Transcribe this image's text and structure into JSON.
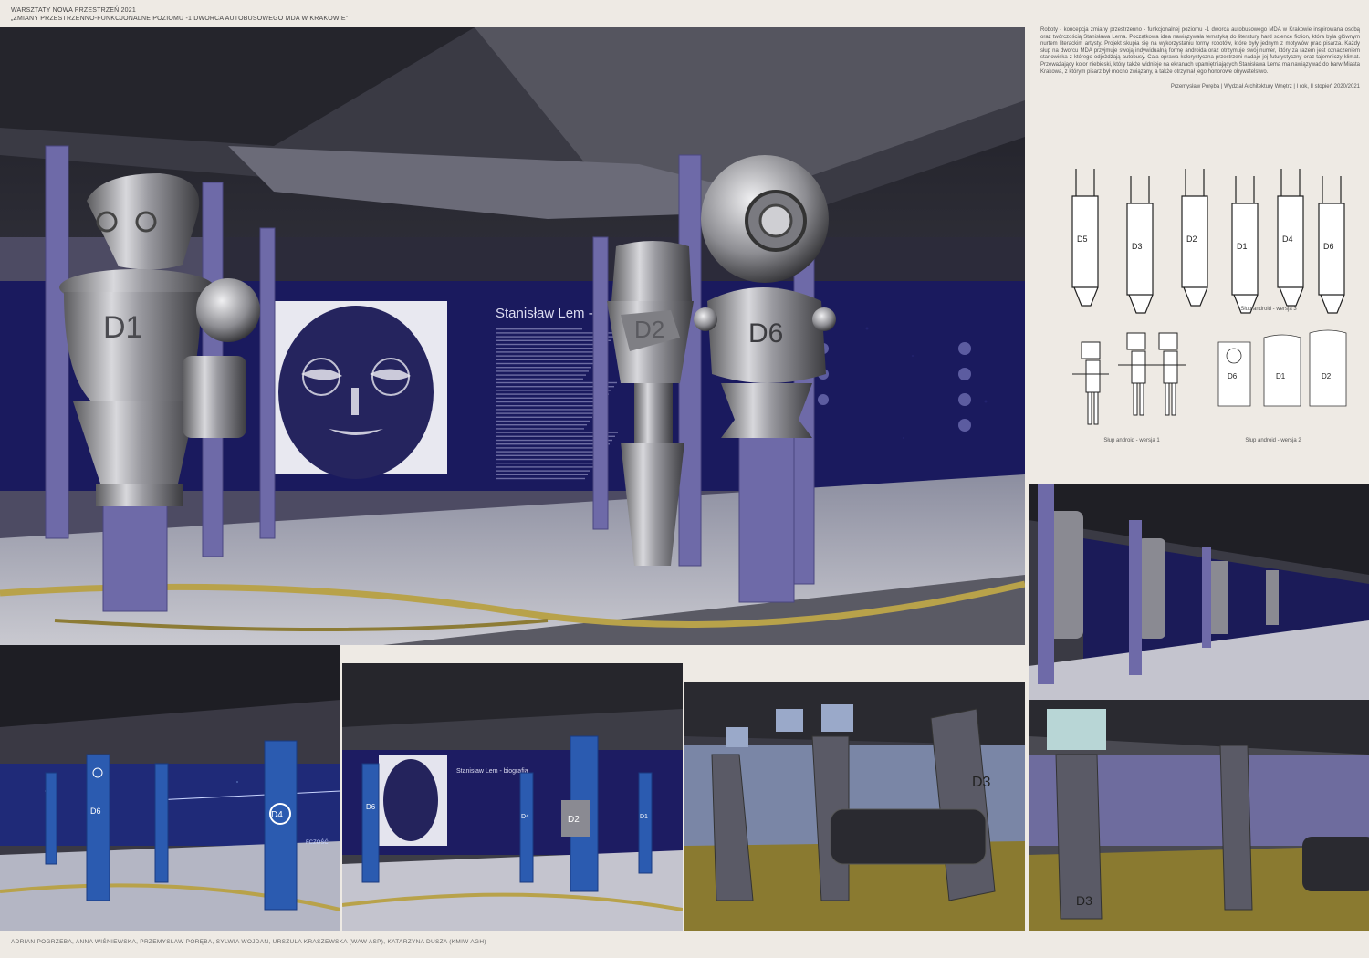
{
  "header": {
    "line1": "WARSZTATY NOWA PRZESTRZEŃ 2021",
    "line2": "„ZMIANY PRZESTRZENNO-FUNKCJONALNE POZIOMU -1 DWORCA AUTOBUSOWEGO MDA W KRAKOWIE”"
  },
  "description": "Roboty - koncepcja zmiany przestrzenno - funkcjonalnej poziomu -1 dworca autobusowego MDA w Krakowie inspirowana osobą oraz twórczością Stanisława Lema. Początkowa idea nawiązywała tematyką do literatury hard science fiction, która była głównym nurtem literackim artysty. Projekt skupia się na wykorzystaniu formy robotów, które były jednym z motywów prac pisarza. Każdy słup na dworcu MDA przyjmuje swoją indywidualną formę androida oraz otrzymuje swój numer, który za razem jest oznaczeniem stanowiska z którego odjeżdżają autobusy. Cała oprawa kolorystyczna przestrzeni nadaje jej futurystyczny oraz tajemniczy klimat. Przeważający kolor niebieski, który także widnieje na ekranach upamiętniających Stanisława Lema ma nawiązywać do barw Miasta Krakowa, z którym pisarz był mocno związany, a także otrzymał jego honorowe obywatelstwo.",
  "credit": "Przemysław Poręba | Wydział Architektury Wnętrz | I rok, II stopień  2020/2021",
  "captions": {
    "v3": "Słup android - wersja 3",
    "v1": "Słup android - wersja 1",
    "v2": "Słup android - wersja 2"
  },
  "drawing_labels": {
    "v3": [
      "D5",
      "D3",
      "D2",
      "D1",
      "D4",
      "D6"
    ],
    "v2": [
      "D6",
      "D1",
      "D2"
    ]
  },
  "main_render": {
    "screen_title": "Stanisław Lem - b",
    "robots": [
      "D1",
      "D2",
      "D6"
    ]
  },
  "small_renders": {
    "s1_labels": [
      "D6",
      "D4"
    ],
    "s1_word": "FCZOŚĆ",
    "s2_title": "Stanisław Lem - biografia",
    "s2_labels": [
      "D6",
      "D4",
      "D2",
      "D1"
    ],
    "s3_label": "D3",
    "r2_label": "D3"
  },
  "footer": "ADRIAN POGRZEBA, ANNA WIŚNIEWSKA, PRZEMYSŁAW PORĘBA, SYLWIA WOJDAN, URSZULA KRASZEWSKA (WAW ASP), KATARZYNA DUSZA (KMIW AGH)",
  "colors": {
    "background": "#eeeae4",
    "screen_blue": "#1a1a5e",
    "column_purple": "#6e6aa8",
    "floor_gold": "#b8a24a",
    "ceiling_dark": "#2a2a32"
  }
}
